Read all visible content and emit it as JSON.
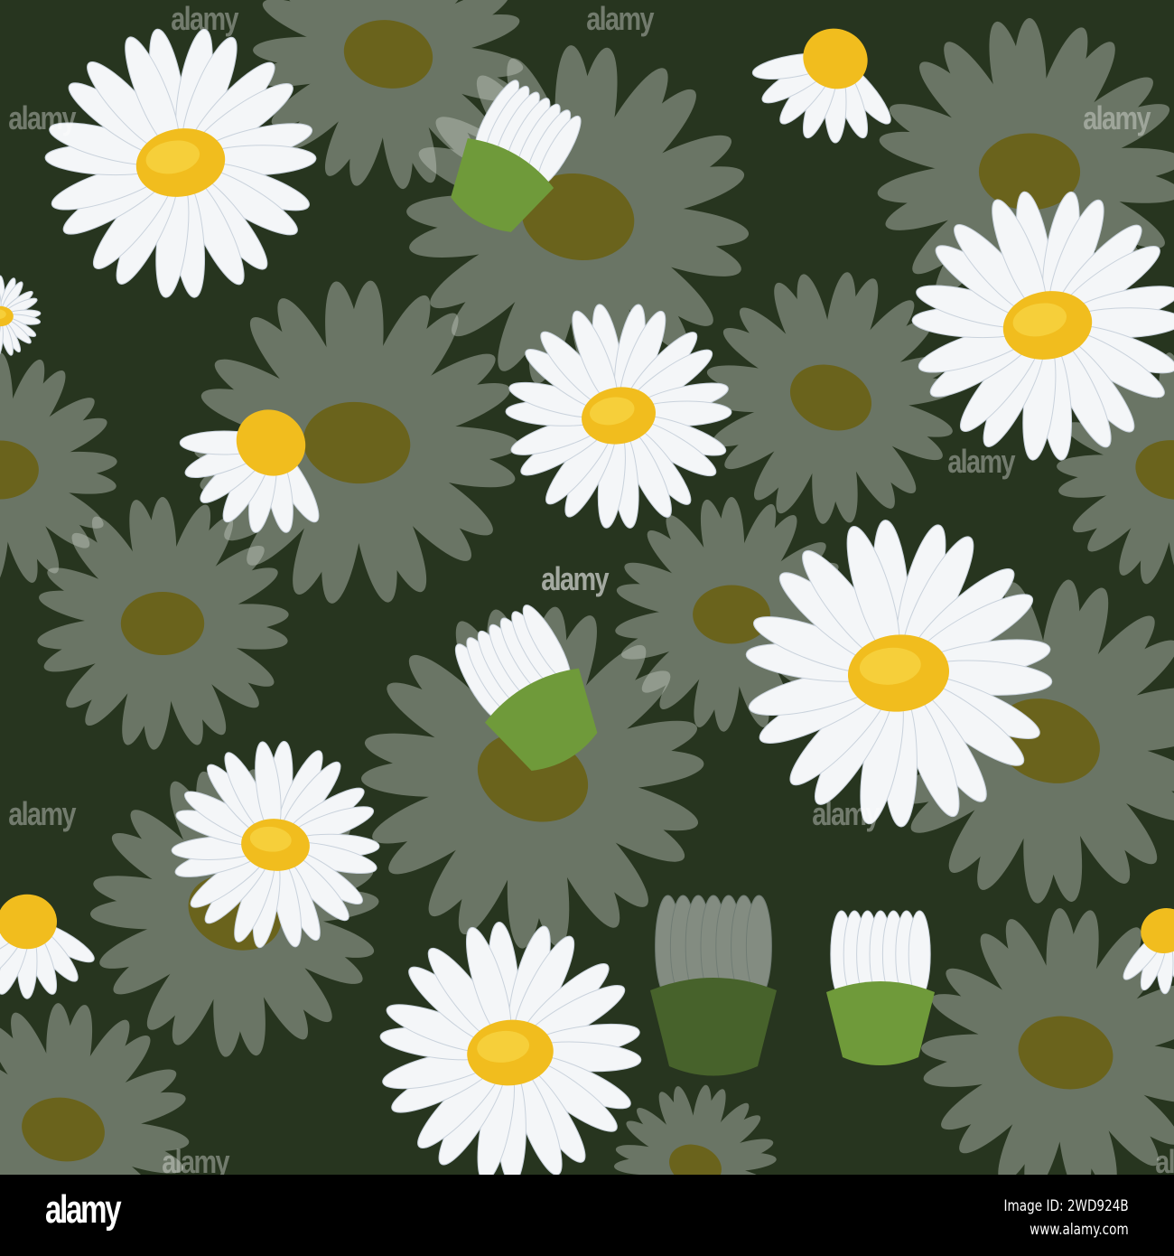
{
  "image": {
    "subject": "daisy-pattern",
    "background_color": "#27351f",
    "petal_color": "#f4f6f8",
    "center_color": "#f1bd1e",
    "bud_color": "#6f9a3a"
  },
  "watermark": "alamy",
  "footer": {
    "logo": "alamy",
    "image_id": "Image ID: 2WD924B",
    "url": "www.alamy.com"
  }
}
